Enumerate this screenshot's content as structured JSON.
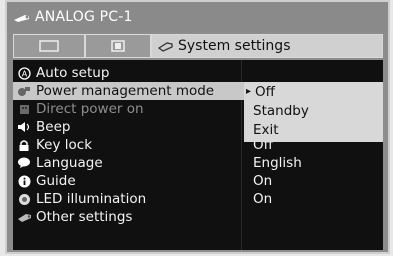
{
  "title": "ANALOG PC-1",
  "tabs": {
    "active_label": "System settings"
  },
  "menu": [
    {
      "label": "Auto setup",
      "value": "",
      "icon": "a-circle-icon",
      "state": "normal"
    },
    {
      "label": "Power management mode",
      "value": "",
      "icon": "power-icon",
      "state": "selected"
    },
    {
      "label": "Direct power on",
      "value": "",
      "icon": "plug-icon",
      "state": "dim"
    },
    {
      "label": "Beep",
      "value": "",
      "icon": "speaker-icon",
      "state": "normal"
    },
    {
      "label": "Key lock",
      "value": "Off",
      "icon": "lock-icon",
      "state": "normal"
    },
    {
      "label": "Language",
      "value": "English",
      "icon": "speech-bubble-icon",
      "state": "normal"
    },
    {
      "label": "Guide",
      "value": "On",
      "icon": "info-icon",
      "state": "normal"
    },
    {
      "label": "LED illumination",
      "value": "On",
      "icon": "led-icon",
      "state": "normal"
    },
    {
      "label": "Other settings",
      "value": "",
      "icon": "other-settings-icon",
      "state": "normal"
    }
  ],
  "dropdown": {
    "options": [
      "Off",
      "Standby",
      "Exit"
    ],
    "selected": "Off"
  }
}
